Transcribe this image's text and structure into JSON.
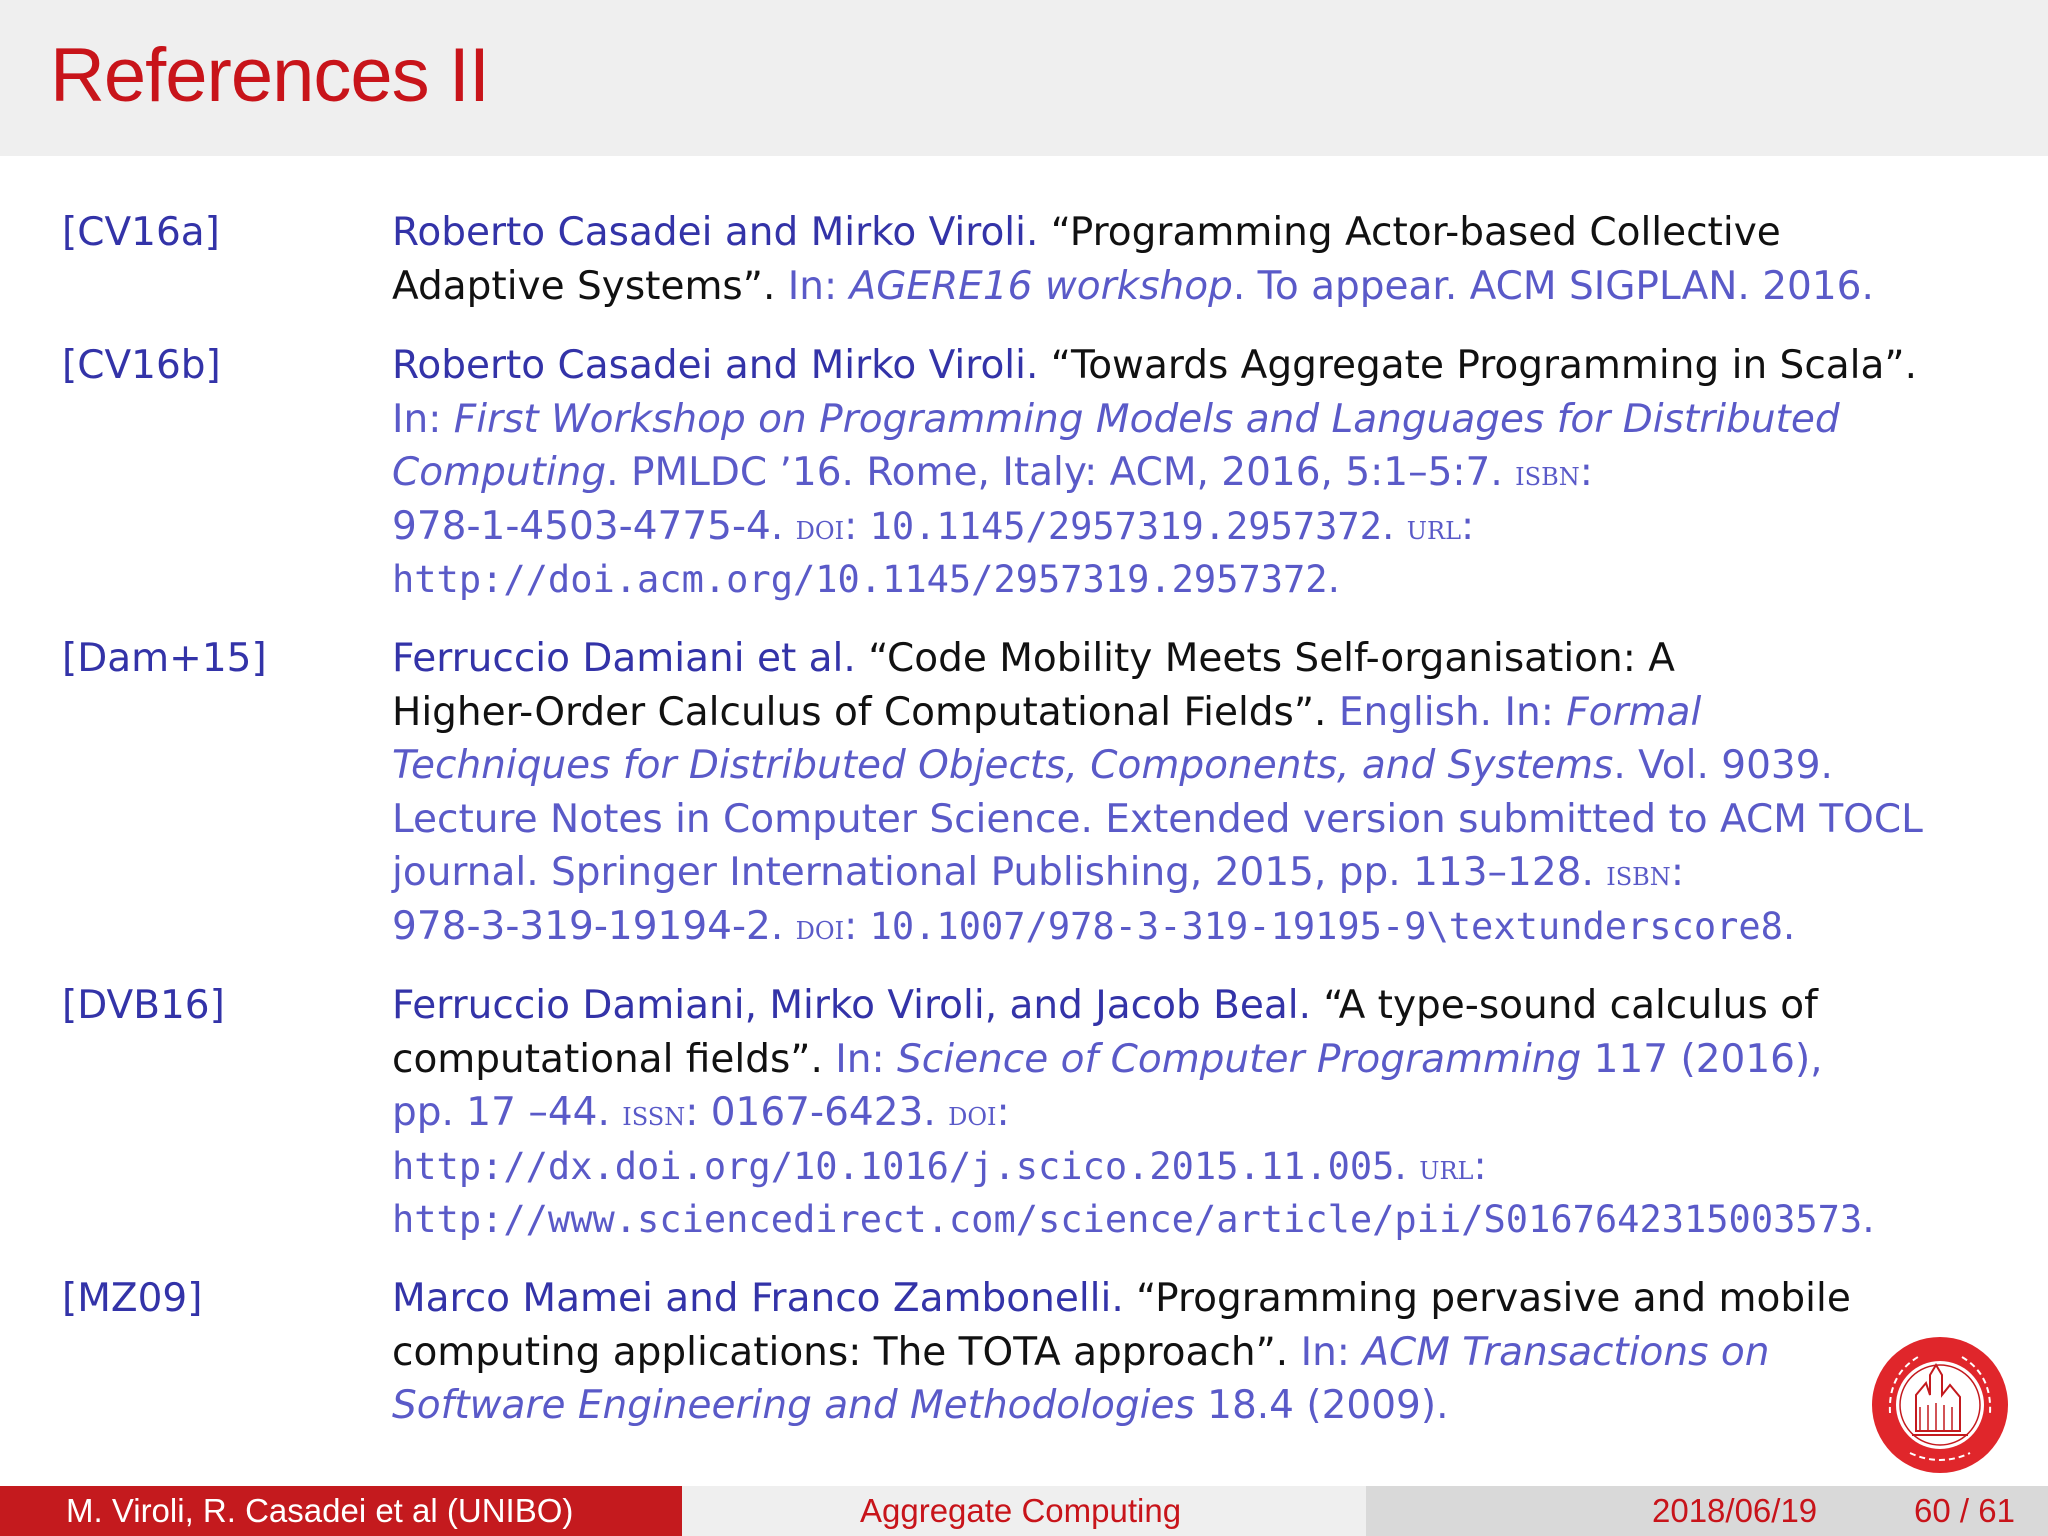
{
  "slide": {
    "title": "References II"
  },
  "references": [
    {
      "key": "[CV16a]",
      "lines": [
        [
          {
            "s": "b",
            "t": "Roberto Casadei and Mirko Viroli."
          },
          {
            "s": "t",
            "t": " “Programming Actor-based Collective"
          }
        ],
        [
          {
            "s": "t",
            "t": "Adaptive Systems”. "
          },
          {
            "s": "i",
            "t": "In: "
          },
          {
            "s": "it",
            "t": "AGERE16 workshop"
          },
          {
            "s": "i",
            "t": ". To appear. ACM SIGPLAN. 2016."
          }
        ]
      ]
    },
    {
      "key": "[CV16b]",
      "lines": [
        [
          {
            "s": "b",
            "t": "Roberto Casadei and Mirko Viroli."
          },
          {
            "s": "t",
            "t": " “Towards Aggregate Programming in Scala”."
          }
        ],
        [
          {
            "s": "i",
            "t": "In: "
          },
          {
            "s": "it",
            "t": "First Workshop on Programming Models and Languages for Distributed"
          }
        ],
        [
          {
            "s": "it",
            "t": "Computing"
          },
          {
            "s": "i",
            "t": ". PMLDC ’16. Rome, Italy: ACM, 2016, 5:1–5:7. "
          },
          {
            "s": "sc",
            "t": "isbn"
          },
          {
            "s": "i",
            "t": ":"
          }
        ],
        [
          {
            "s": "i",
            "t": "978-1-4503-4775-4. "
          },
          {
            "s": "sc",
            "t": "doi"
          },
          {
            "s": "i",
            "t": ": "
          },
          {
            "s": "mono",
            "t": "10.1145/2957319.2957372"
          },
          {
            "s": "i",
            "t": ". "
          },
          {
            "s": "sc",
            "t": "url"
          },
          {
            "s": "i",
            "t": ":"
          }
        ],
        [
          {
            "s": "mono",
            "t": "http://doi.acm.org/10.1145/2957319.2957372"
          },
          {
            "s": "i",
            "t": "."
          }
        ]
      ]
    },
    {
      "key": "[Dam+15]",
      "lines": [
        [
          {
            "s": "b",
            "t": "Ferruccio Damiani et al."
          },
          {
            "s": "t",
            "t": " “Code Mobility Meets Self-organisation: A"
          }
        ],
        [
          {
            "s": "t",
            "t": "Higher-Order Calculus of Computational Fields”. "
          },
          {
            "s": "i",
            "t": "English. In: "
          },
          {
            "s": "it",
            "t": "Formal"
          }
        ],
        [
          {
            "s": "it",
            "t": "Techniques for Distributed Objects, Components, and Systems"
          },
          {
            "s": "i",
            "t": ". Vol. 9039."
          }
        ],
        [
          {
            "s": "i",
            "t": "Lecture Notes in Computer Science. Extended version submitted to ACM TOCL"
          }
        ],
        [
          {
            "s": "i",
            "t": "journal. Springer International Publishing, 2015, pp. 113–128. "
          },
          {
            "s": "sc",
            "t": "isbn"
          },
          {
            "s": "i",
            "t": ":"
          }
        ],
        [
          {
            "s": "i",
            "t": "978-3-319-19194-2. "
          },
          {
            "s": "sc",
            "t": "doi"
          },
          {
            "s": "i",
            "t": ": "
          },
          {
            "s": "mono",
            "t": "10.1007/978-3-319-19195-9\\textunderscore8"
          },
          {
            "s": "i",
            "t": "."
          }
        ]
      ]
    },
    {
      "key": "[DVB16]",
      "lines": [
        [
          {
            "s": "b",
            "t": "Ferruccio Damiani, Mirko Viroli, and Jacob Beal."
          },
          {
            "s": "t",
            "t": " “A type-sound calculus of"
          }
        ],
        [
          {
            "s": "t",
            "t": "computational fields”. "
          },
          {
            "s": "i",
            "t": "In: "
          },
          {
            "s": "it",
            "t": "Science of Computer Programming"
          },
          {
            "s": "i",
            "t": " 117 (2016),"
          }
        ],
        [
          {
            "s": "i",
            "t": "pp. 17 –44. "
          },
          {
            "s": "sc",
            "t": "issn"
          },
          {
            "s": "i",
            "t": ": 0167-6423. "
          },
          {
            "s": "sc",
            "t": "doi"
          },
          {
            "s": "i",
            "t": ":"
          }
        ],
        [
          {
            "s": "mono",
            "t": "http://dx.doi.org/10.1016/j.scico.2015.11.005"
          },
          {
            "s": "i",
            "t": ". "
          },
          {
            "s": "sc",
            "t": "url"
          },
          {
            "s": "i",
            "t": ":"
          }
        ],
        [
          {
            "s": "mono",
            "t": "http://www.sciencedirect.com/science/article/pii/S0167642315003573"
          },
          {
            "s": "i",
            "t": "."
          }
        ]
      ]
    },
    {
      "key": "[MZ09]",
      "lines": [
        [
          {
            "s": "b",
            "t": "Marco Mamei and Franco Zambonelli."
          },
          {
            "s": "t",
            "t": " “Programming pervasive and mobile"
          }
        ],
        [
          {
            "s": "t",
            "t": "computing applications: The TOTA approach”. "
          },
          {
            "s": "i",
            "t": "In: "
          },
          {
            "s": "it",
            "t": "ACM Transactions on"
          }
        ],
        [
          {
            "s": "it",
            "t": "Software Engineering and Methodologies"
          },
          {
            "s": "i",
            "t": " 18.4 (2009)."
          }
        ]
      ]
    }
  ],
  "footer": {
    "authors": "M. Viroli, R. Casadei et al  (UNIBO)",
    "talk_title": "Aggregate Computing",
    "date": "2018/06/19",
    "page": "60 / 61"
  },
  "colors": {
    "title_red": "#c8141a",
    "footer_red": "#c41a1e",
    "author_blue": "#3333a8",
    "meta_blue": "#5a5ac8"
  }
}
